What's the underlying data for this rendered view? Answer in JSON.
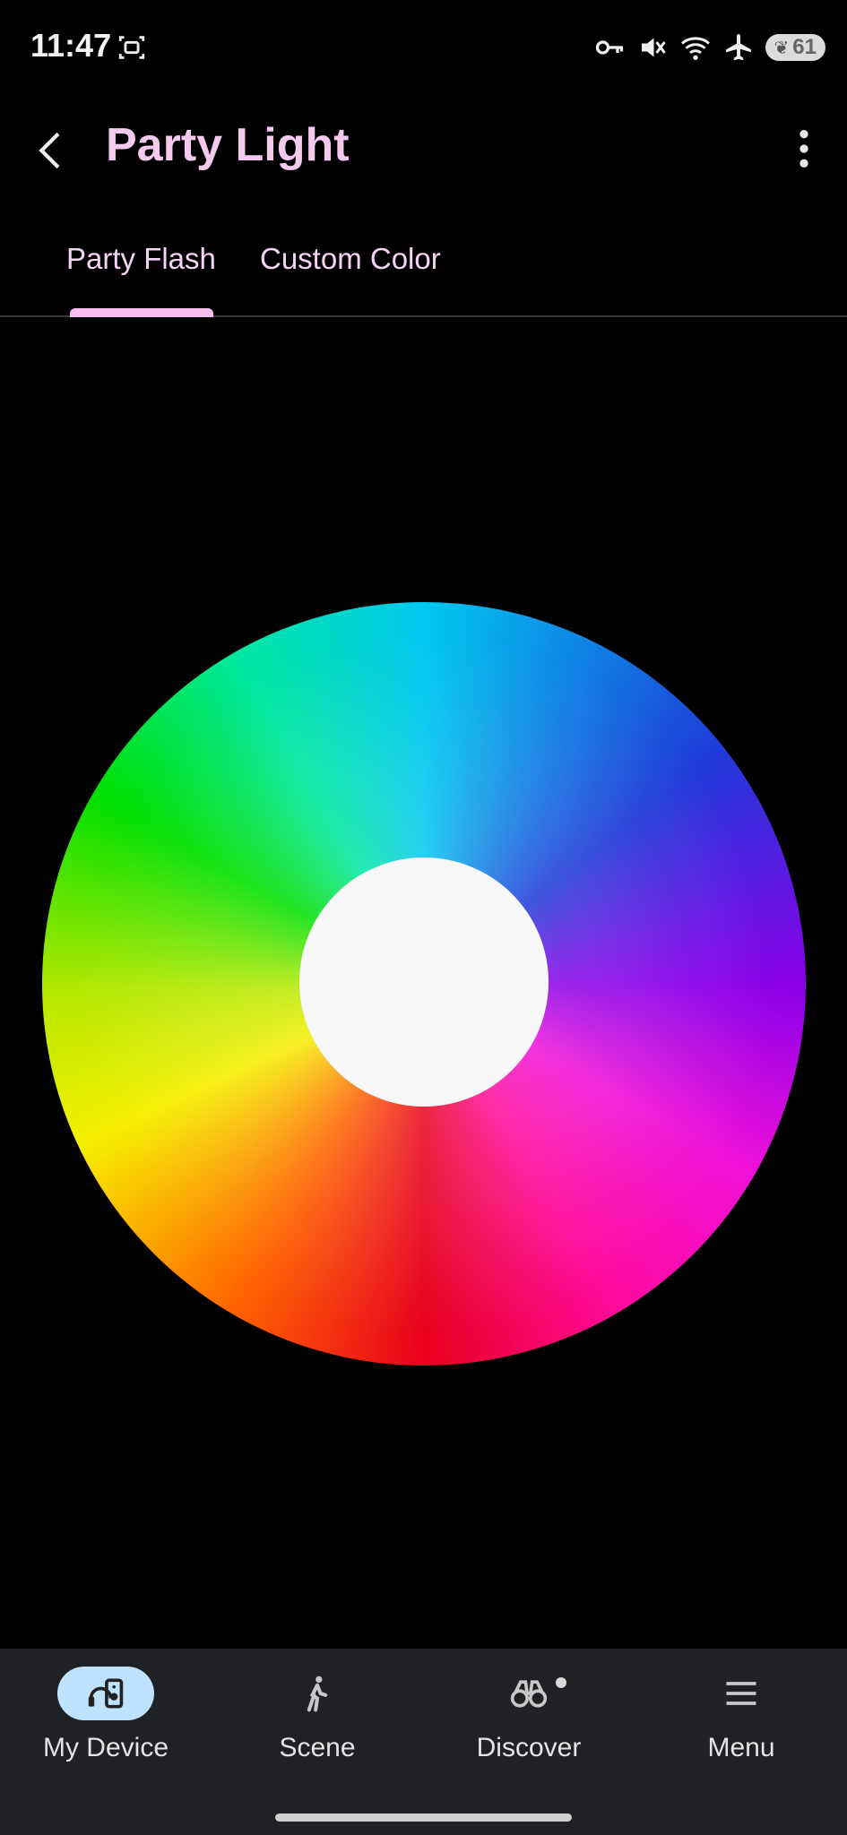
{
  "status_bar": {
    "time": "11:47",
    "battery": "61",
    "icons": [
      "screenshot-icon",
      "vpn-key-icon",
      "mute-icon",
      "wifi-icon",
      "airplane-icon",
      "battery-icon"
    ]
  },
  "header": {
    "title": "Party Light",
    "back_icon": "chevron-left-icon",
    "more_icon": "more-vertical-icon"
  },
  "tabs": [
    {
      "label": "Party Flash",
      "active": true
    },
    {
      "label": "Custom Color",
      "active": false
    }
  ],
  "color_wheel": {
    "center_color": "#f8f8f8"
  },
  "bottom_nav": [
    {
      "label": "My Device",
      "icon": "speaker-icon",
      "active": true
    },
    {
      "label": "Scene",
      "icon": "walking-icon",
      "active": false
    },
    {
      "label": "Discover",
      "icon": "binoculars-icon",
      "active": false,
      "badge": true
    },
    {
      "label": "Menu",
      "icon": "hamburger-menu-icon",
      "active": false
    }
  ],
  "colors": {
    "title": "#f4c9ee",
    "tab_indicator": "#f6bff0",
    "nav_active_pill": "#bfe3ff",
    "nav_background": "#1f2124"
  }
}
